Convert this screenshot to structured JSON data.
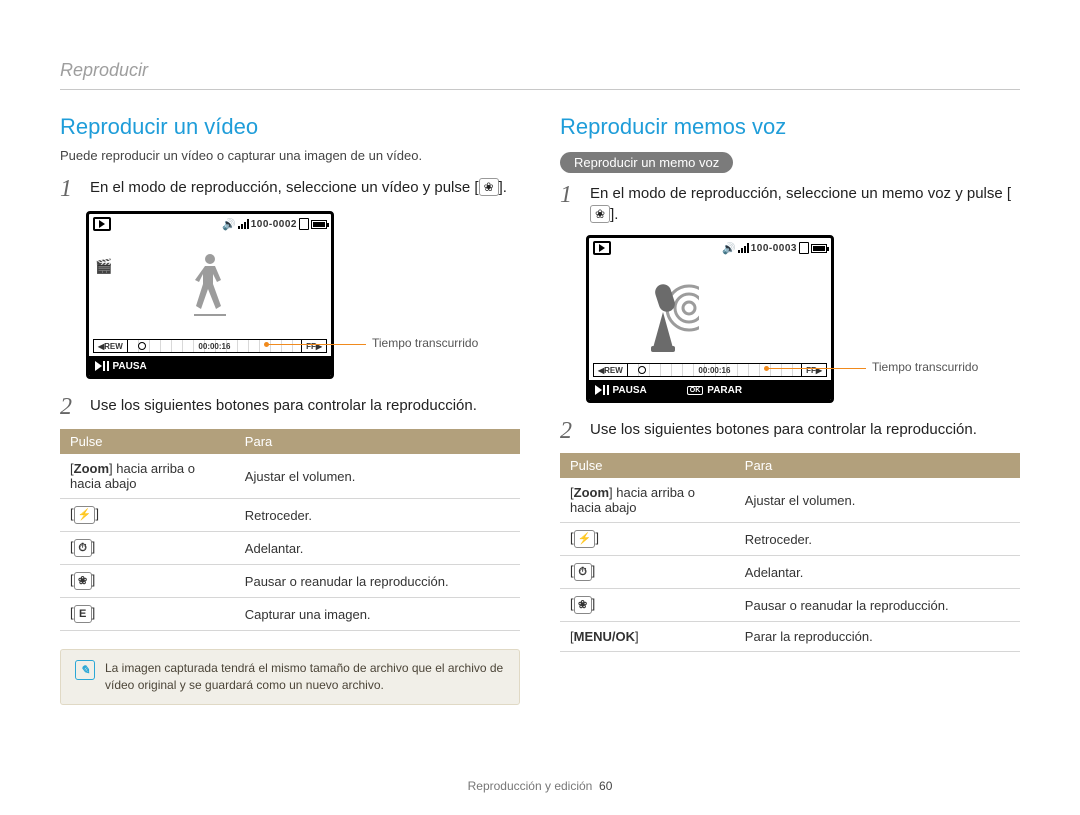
{
  "breadcrumb": "Reproducir",
  "left": {
    "heading": "Reproducir un vídeo",
    "lead": "Puede reproducir un vídeo o capturar una imagen de un vídeo.",
    "step1": "En el modo de reproducción, seleccione un vídeo y pulse [",
    "step1_icon": "❀",
    "step1_tail": "].",
    "lcd": {
      "counter": "100-0002",
      "time": "00:00:16",
      "rew": "REW",
      "ff": "FF",
      "bottom_pause": "PAUSA"
    },
    "callout": "Tiempo transcurrido",
    "step2": "Use los siguientes botones para controlar la reproducción.",
    "table": {
      "h1": "Pulse",
      "h2": "Para",
      "rows": [
        {
          "pulse_html": "[<b>Zoom</b>] hacia arriba o hacia abajo",
          "para": "Ajustar el volumen."
        },
        {
          "pulse_key": "⚡",
          "para": "Retroceder."
        },
        {
          "pulse_key": "⏱",
          "para": "Adelantar."
        },
        {
          "pulse_key": "❀",
          "para": "Pausar o reanudar la reproducción."
        },
        {
          "pulse_key": "E",
          "para": "Capturar una imagen."
        }
      ]
    },
    "note": "La imagen capturada tendrá el mismo tamaño de archivo que el archivo de vídeo original y se guardará como un nuevo archivo."
  },
  "right": {
    "heading": "Reproducir memos voz",
    "pill": "Reproducir un memo voz",
    "step1": "En el modo de reproducción, seleccione un memo voz y pulse [",
    "step1_icon": "❀",
    "step1_tail": "].",
    "lcd": {
      "counter": "100-0003",
      "time": "00:00:16",
      "rew": "REW",
      "ff": "FF",
      "bottom_pause": "PAUSA",
      "bottom_stop": "PARAR"
    },
    "callout": "Tiempo transcurrido",
    "step2": "Use los siguientes botones para controlar la reproducción.",
    "table": {
      "h1": "Pulse",
      "h2": "Para",
      "rows": [
        {
          "pulse_html": "[<b>Zoom</b>] hacia arriba o hacia abajo",
          "para": "Ajustar el volumen."
        },
        {
          "pulse_key": "⚡",
          "para": "Retroceder."
        },
        {
          "pulse_key": "⏱",
          "para": "Adelantar."
        },
        {
          "pulse_key": "❀",
          "para": "Pausar o reanudar la reproducción."
        },
        {
          "pulse_html": "[<b>MENU/OK</b>]",
          "para": "Parar la reproducción."
        }
      ]
    }
  },
  "footer": {
    "section": "Reproducción y edición",
    "page": "60"
  }
}
